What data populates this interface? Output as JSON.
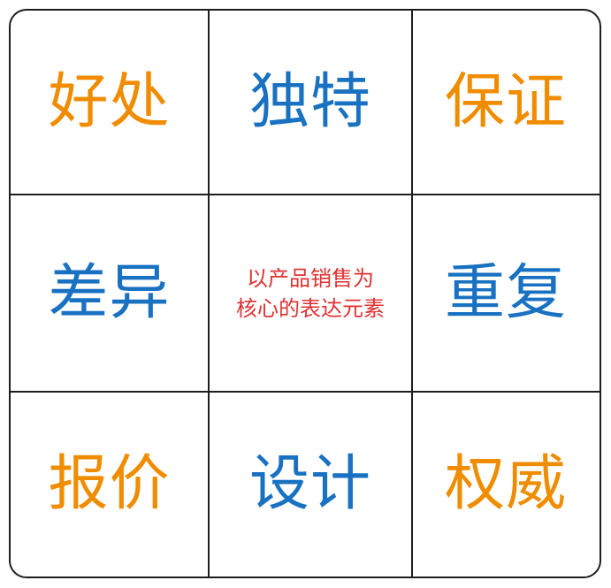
{
  "grid": {
    "cells": [
      {
        "label": "好处",
        "color": "#f08c00"
      },
      {
        "label": "独特",
        "color": "#1971c2"
      },
      {
        "label": "保证",
        "color": "#f08c00"
      },
      {
        "label": "差异",
        "color": "#1971c2"
      },
      {
        "center_lines": [
          "以产品销售为",
          "核心的表达元素"
        ],
        "color": "#e03131"
      },
      {
        "label": "重复",
        "color": "#1971c2"
      },
      {
        "label": "报价",
        "color": "#f08c00"
      },
      {
        "label": "设计",
        "color": "#1971c2"
      },
      {
        "label": "权威",
        "color": "#f08c00"
      }
    ]
  }
}
